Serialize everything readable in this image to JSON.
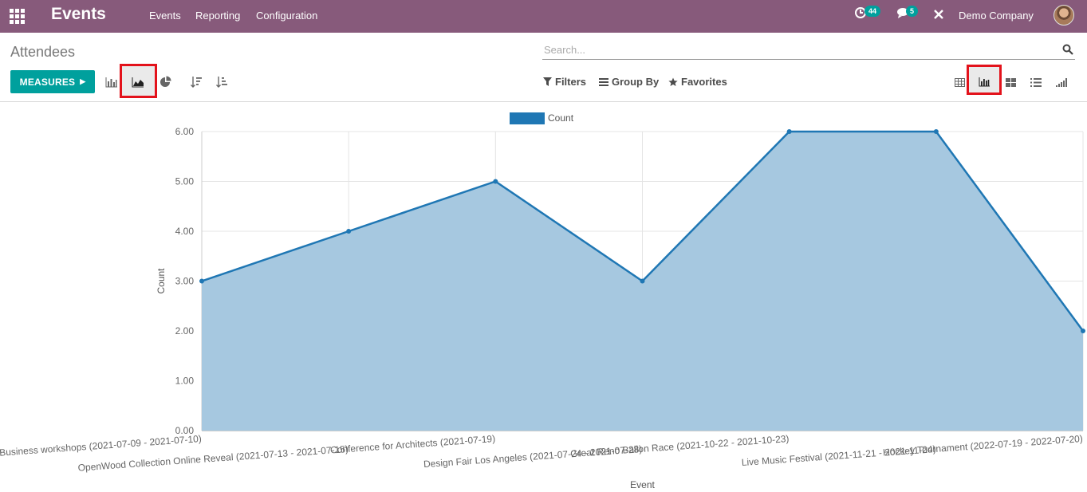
{
  "topbar": {
    "app_name": "Events",
    "menu": [
      "Events",
      "Reporting",
      "Configuration"
    ],
    "activity_count": "44",
    "message_count": "5",
    "company": "Demo Company",
    "bg_color": "#875a7b"
  },
  "control_panel": {
    "breadcrumb": "Attendees",
    "search_placeholder": "Search...",
    "measures_label": "MEASURES",
    "filters_label": "Filters",
    "groupby_label": "Group By",
    "favorites_label": "Favorites",
    "chart_modes": [
      "bar-chart-icon",
      "line-chart-icon",
      "pie-chart-icon"
    ],
    "active_chart_mode": "line-chart-icon",
    "sort_buttons": [
      "sort-descending-icon",
      "sort-ascending-icon"
    ],
    "views": [
      "list-view-icon",
      "graph-view-icon",
      "kanban-view-icon",
      "activity-view-icon",
      "cohort-view-icon"
    ],
    "active_view": "graph-view-icon",
    "accent_color": "#00a09d",
    "highlight_color": "#e3121b"
  },
  "chart_data": {
    "type": "area",
    "categories": [
      "Business workshops (2021-07-09 - 2021-07-10)",
      "OpenWood Collection Online Reveal (2021-07-13 - 2021-07-15)",
      "Conference for Architects (2021-07-19)",
      "Design Fair Los Angeles (2021-07-24 - 2021-07-28)",
      "Great Reno Ballon Race (2021-10-22 - 2021-10-23)",
      "Live Music Festival (2021-11-21 - 2021-11-24)",
      "Hockey Tournament (2022-07-19 - 2022-07-20)"
    ],
    "series": [
      {
        "name": "Count",
        "values": [
          3,
          4,
          5,
          3,
          6,
          6,
          2
        ]
      }
    ],
    "xlabel": "Event",
    "ylabel": "Count",
    "ylim": [
      0,
      6
    ],
    "yticks": [
      "0.00",
      "1.00",
      "2.00",
      "3.00",
      "4.00",
      "5.00",
      "6.00"
    ],
    "grid": true,
    "legend": "top-center",
    "line_color": "#1f77b4",
    "fill_color": "#a6c8e0"
  }
}
